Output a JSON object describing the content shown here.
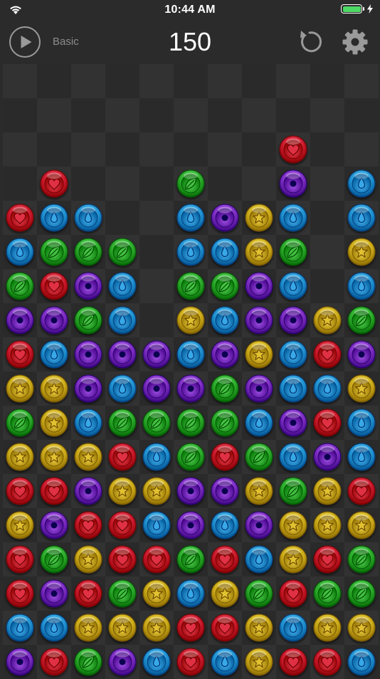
{
  "status": {
    "time": "10:44 AM",
    "battery_color": "#4cd964"
  },
  "toolbar": {
    "mode": "Basic",
    "score": "150"
  },
  "colors": {
    "heart": "#c7172a",
    "drop": "#1f8fce",
    "leaf": "#2ba82a",
    "star": "#c9a818",
    "circle": "#7a2bbf",
    "icon_gray": "#9a9a9a"
  },
  "board": {
    "cols": 11,
    "rows": 18,
    "gems": [
      [
        null,
        null,
        null,
        null,
        null,
        null,
        null,
        null,
        null,
        null,
        null
      ],
      [
        null,
        null,
        null,
        null,
        null,
        null,
        null,
        null,
        null,
        null,
        null
      ],
      [
        null,
        null,
        null,
        null,
        null,
        null,
        null,
        null,
        "heart",
        null,
        null
      ],
      [
        null,
        "heart",
        null,
        null,
        null,
        "leaf",
        null,
        null,
        "circle",
        null,
        "drop"
      ],
      [
        "heart",
        "drop",
        "drop",
        null,
        null,
        "drop",
        "circle",
        "star",
        "drop",
        null,
        "drop"
      ],
      [
        "drop",
        "leaf",
        "leaf",
        "leaf",
        null,
        "drop",
        "drop",
        "star",
        "leaf",
        null,
        "star"
      ],
      [
        "leaf",
        "heart",
        "circle",
        "drop",
        null,
        "leaf",
        "leaf",
        "circle",
        "drop",
        null,
        "drop"
      ],
      [
        "circle",
        "circle",
        "leaf",
        "drop",
        null,
        "star",
        "drop",
        "circle",
        "circle",
        "star",
        "leaf"
      ],
      [
        "heart",
        "drop",
        "circle",
        "circle",
        "circle",
        "drop",
        "circle",
        "star",
        "drop",
        "heart",
        "circle"
      ],
      [
        "star",
        "star",
        "circle",
        "drop",
        "circle",
        "circle",
        "leaf",
        "circle",
        "drop",
        "drop",
        "star"
      ],
      [
        "leaf",
        "star",
        "drop",
        "leaf",
        "leaf",
        "leaf",
        "leaf",
        "drop",
        "circle",
        "heart",
        "drop"
      ],
      [
        "star",
        "star",
        "star",
        "heart",
        "drop",
        "leaf",
        "heart",
        "leaf",
        "drop",
        "circle",
        "drop"
      ],
      [
        "heart",
        "heart",
        "circle",
        "star",
        "star",
        "circle",
        "circle",
        "star",
        "leaf",
        "star",
        "heart"
      ],
      [
        "star",
        "circle",
        "heart",
        "heart",
        "drop",
        "circle",
        "drop",
        "circle",
        "star",
        "star",
        "star"
      ],
      [
        "heart",
        "leaf",
        "star",
        "heart",
        "heart",
        "leaf",
        "heart",
        "drop",
        "star",
        "heart",
        "leaf"
      ],
      [
        "heart",
        "circle",
        "heart",
        "leaf",
        "star",
        "drop",
        "star",
        "leaf",
        "heart",
        "leaf",
        "leaf"
      ],
      [
        "drop",
        "drop",
        "star",
        "star",
        "star",
        "heart",
        "heart",
        "star",
        "drop",
        "star",
        "star"
      ],
      [
        "circle",
        "heart",
        "leaf",
        "circle",
        "drop",
        "heart",
        "drop",
        "star",
        "heart",
        "heart",
        "drop"
      ]
    ]
  }
}
